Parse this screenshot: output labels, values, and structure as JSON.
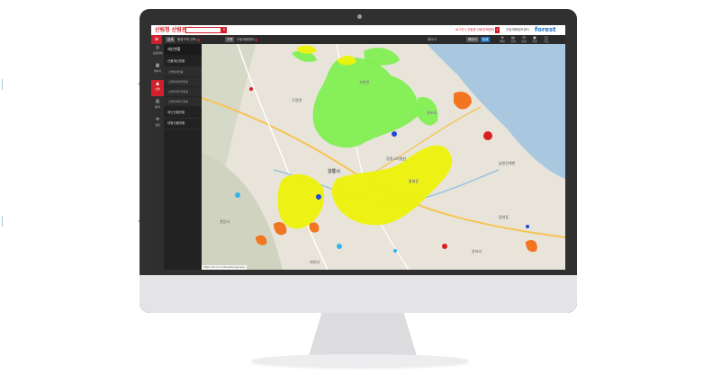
{
  "app": {
    "logo_text": "산림청 산림관제",
    "search_placeholder": ""
  },
  "topbar": {
    "links": "로그인 | 산림청 산림관제센터",
    "badge": "1",
    "right_text": "산림재해정보센터",
    "brand": "forest",
    "brand_sub": "산림청"
  },
  "navbar": {
    "chip1": "검색",
    "crumb1": "행정구역 선택",
    "chip2": "지역",
    "crumb2": "산림재해정보",
    "tool_label": "레이어",
    "tool_btn1": "레이어",
    "tool_btn2": "범례",
    "tool_icons": [
      {
        "icon": "zoom-icon",
        "label": "확대"
      },
      {
        "icon": "print-icon",
        "label": "인쇄"
      },
      {
        "icon": "measure-icon",
        "label": "측정"
      },
      {
        "icon": "save-icon",
        "label": "저장"
      },
      {
        "icon": "map-icon",
        "label": "지도"
      }
    ]
  },
  "rail": [
    {
      "icon": "globe-icon",
      "label": "산림재해"
    },
    {
      "icon": "layers-icon",
      "label": "레이어"
    },
    {
      "icon": "fire-icon",
      "label": "산불"
    },
    {
      "icon": "chart-icon",
      "label": "통계"
    },
    {
      "icon": "gear-icon",
      "label": "설정"
    }
  ],
  "panel": {
    "head": "재난현황",
    "items": [
      {
        "label": "산불재난현황"
      },
      {
        "label": "재난산불현황"
      },
      {
        "label": "대형산불현황"
      }
    ],
    "subs": [
      {
        "label": "산불발생현황"
      },
      {
        "label": "산불피해면적현황"
      },
      {
        "label": "산불피해지역현황"
      },
      {
        "label": "산불피해복구현황"
      }
    ]
  },
  "map": {
    "labels": [
      "강릉시",
      "강릉고려병원",
      "경포호",
      "구정면",
      "사천면",
      "관음리",
      "여찬리",
      "남항진해변",
      "양지리",
      "장현동",
      "홍제동"
    ],
    "status": "http://10.1.1.1/forest/mapview"
  },
  "colors": {
    "brand_red": "#d0202b",
    "dark": "#2b2b2b",
    "sea": "#a9c8e0",
    "zone_yellow": "#eef20a",
    "zone_green": "#7bf04a",
    "zone_orange": "#f27522",
    "zone_blue": "#1e48d8",
    "zone_cyan": "#33b5f0",
    "zone_red": "#d92020"
  }
}
